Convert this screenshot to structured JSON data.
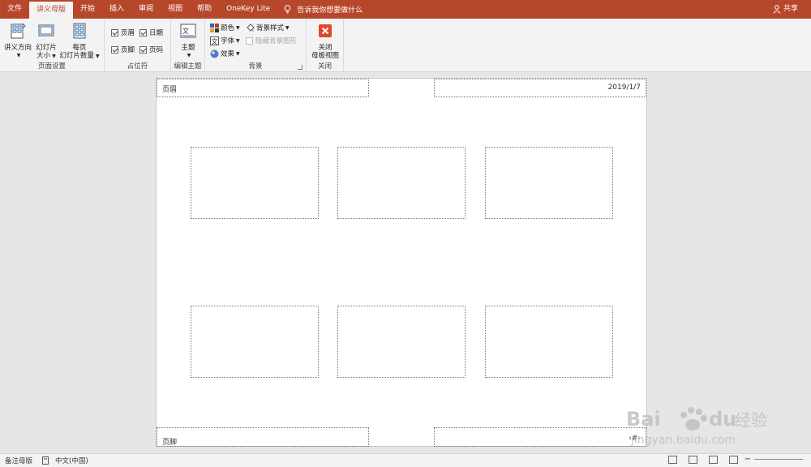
{
  "tabs": [
    "文件",
    "讲义母版",
    "开始",
    "插入",
    "审阅",
    "视图",
    "帮助",
    "OneKey Lite"
  ],
  "active_tab_index": 1,
  "tell_me": "告诉我你想要做什么",
  "share": "共享",
  "ribbon": {
    "page_setup": {
      "label": "页面设置",
      "handout_orientation": "讲义方向",
      "slide_size_line1": "幻灯片",
      "slide_size_line2": "大小",
      "slides_per_page_line1": "每页",
      "slides_per_page_line2": "幻灯片数量"
    },
    "placeholders": {
      "label": "占位符",
      "header": "页眉",
      "date": "日期",
      "footer": "页脚",
      "page_number": "页码",
      "header_checked": true,
      "date_checked": true,
      "footer_checked": true,
      "page_number_checked": true
    },
    "edit_theme": {
      "label": "编辑主题",
      "theme": "主题"
    },
    "background": {
      "label": "背景",
      "colors": "颜色",
      "fonts": "字体",
      "effects": "效果",
      "background_styles": "背景样式",
      "hide_background_graphics": "隐藏背景图形",
      "hide_checked": false
    },
    "close": {
      "label": "关闭",
      "close_line1": "关闭",
      "close_line2": "母板视图"
    }
  },
  "canvas": {
    "header_text": "页眉",
    "date_text": "2019/1/7",
    "footer_text": "页脚",
    "page_number_text": "‹#›",
    "slides_per_page": 6
  },
  "status": {
    "view_name": "备注母版",
    "language": "中文(中国)"
  },
  "watermark": {
    "text": "Bai du 经验",
    "url": "jingyan.baidu.com"
  },
  "colors": {
    "accent": "#b7472a",
    "ribbon_bg": "#f3f3f3",
    "workspace_bg": "#e6e6e6",
    "close_red": "#e0482b"
  }
}
